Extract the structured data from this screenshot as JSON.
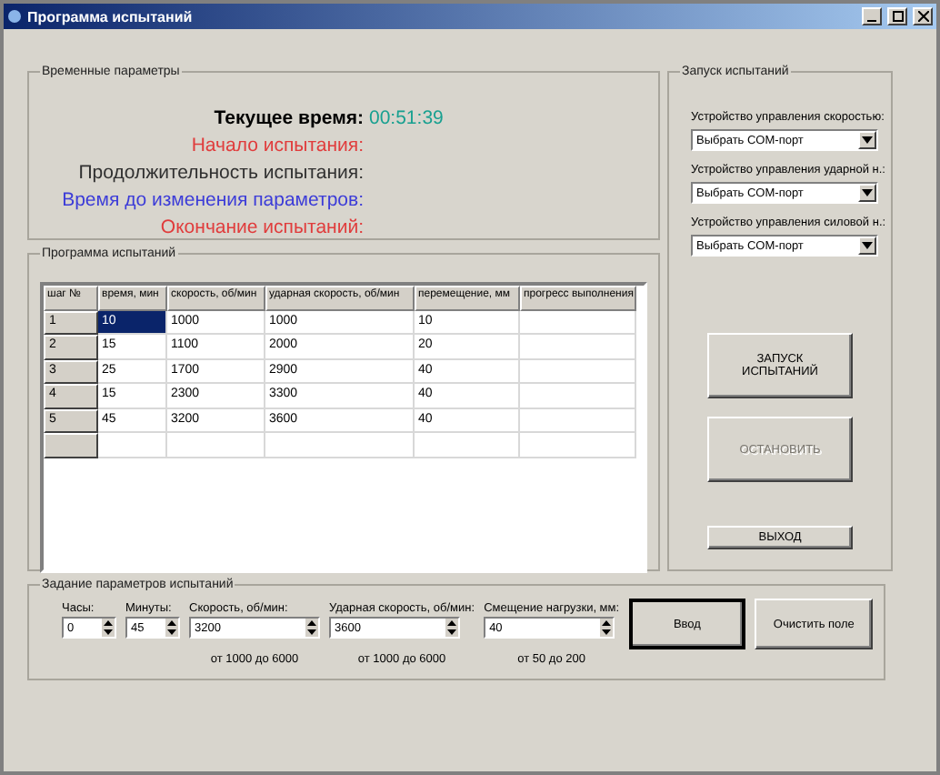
{
  "window": {
    "title": "Программа испытаний"
  },
  "time_group": {
    "legend": "Временные параметры",
    "lines": [
      {
        "label": "Текущее время:",
        "value": "00:51:39",
        "color": "#000000",
        "kind": "clock"
      },
      {
        "label": "Начало испытания:",
        "color": "#e03c3c",
        "kind": "plain"
      },
      {
        "label": "Продолжительность испытания:",
        "color": "#303030",
        "kind": "plain"
      },
      {
        "label": "Время до изменения параметров:",
        "color": "#3c3cd8",
        "kind": "plain"
      },
      {
        "label": "Окончание испытаний:",
        "color": "#e03c3c",
        "kind": "plain"
      }
    ]
  },
  "program_group": {
    "legend": "Программа испытаний",
    "table": {
      "columns": [
        "шаг №",
        "время, мин",
        "скорость, об/мин",
        "ударная скорость, об/мин",
        "перемещение, мм",
        "прогресс выполнения"
      ],
      "rows": [
        {
          "cells": [
            {
              "text": "1",
              "selected": false
            },
            {
              "text": "10",
              "selected": true
            },
            {
              "text": "1000",
              "selected": false
            },
            {
              "text": "1000",
              "selected": false
            },
            {
              "text": "10",
              "selected": false
            },
            {
              "text": "",
              "selected": false
            }
          ]
        },
        {
          "cells": [
            {
              "text": "2",
              "selected": false
            },
            {
              "text": "15",
              "selected": false
            },
            {
              "text": "1100",
              "selected": false
            },
            {
              "text": "2000",
              "selected": false
            },
            {
              "text": "20",
              "selected": false
            },
            {
              "text": "",
              "selected": false
            }
          ]
        },
        {
          "cells": [
            {
              "text": "3",
              "selected": false
            },
            {
              "text": "25",
              "selected": false
            },
            {
              "text": "1700",
              "selected": false
            },
            {
              "text": "2900",
              "selected": false
            },
            {
              "text": "40",
              "selected": false
            },
            {
              "text": "",
              "selected": false
            }
          ]
        },
        {
          "cells": [
            {
              "text": "4",
              "selected": false
            },
            {
              "text": "15",
              "selected": false
            },
            {
              "text": "2300",
              "selected": false
            },
            {
              "text": "3300",
              "selected": false
            },
            {
              "text": "40",
              "selected": false
            },
            {
              "text": "",
              "selected": false
            }
          ]
        },
        {
          "cells": [
            {
              "text": "5",
              "selected": false
            },
            {
              "text": "45",
              "selected": false
            },
            {
              "text": "3200",
              "selected": false
            },
            {
              "text": "3600",
              "selected": false
            },
            {
              "text": "40",
              "selected": false
            },
            {
              "text": "",
              "selected": false
            }
          ]
        }
      ]
    }
  },
  "launch_group": {
    "legend": "Запуск испытаний",
    "devices": [
      {
        "label": "Устройство управления скоростью:",
        "value": "Выбрать COM-порт"
      },
      {
        "label": "Устройство управления ударной н.:",
        "value": "Выбрать COM-порт"
      },
      {
        "label": "Устройство управления силовой н.:",
        "value": "Выбрать COM-порт"
      }
    ],
    "buttons": [
      {
        "label": "ЗАПУСК ИСПЫТАНИЙ",
        "disabled": false,
        "kind": "big"
      },
      {
        "label": "ОСТАНОВИТЬ",
        "disabled": true,
        "kind": "big"
      },
      {
        "label": "ВЫХОД",
        "disabled": false,
        "kind": "small"
      }
    ]
  },
  "params_group": {
    "legend": "Задание параметров испытаний",
    "fields": [
      {
        "label": "Часы:",
        "value": "0",
        "kind": "narrow"
      },
      {
        "label": "Минуты:",
        "value": "45",
        "kind": "narrow"
      },
      {
        "label": "Скорость, об/мин:",
        "value": "3200",
        "hint": "от 1000  до 6000",
        "kind": "wide"
      },
      {
        "label": "Ударная скорость, об/мин:",
        "value": "3600",
        "hint": "от 1000 до 6000",
        "kind": "wide"
      },
      {
        "label": "Смещение нагрузки, мм:",
        "value": "40",
        "hint": "от 50 до 200",
        "kind": "wide"
      }
    ],
    "buttons": [
      {
        "label": "Ввод",
        "default": true
      },
      {
        "label": "Очистить поле",
        "default": false
      }
    ]
  }
}
